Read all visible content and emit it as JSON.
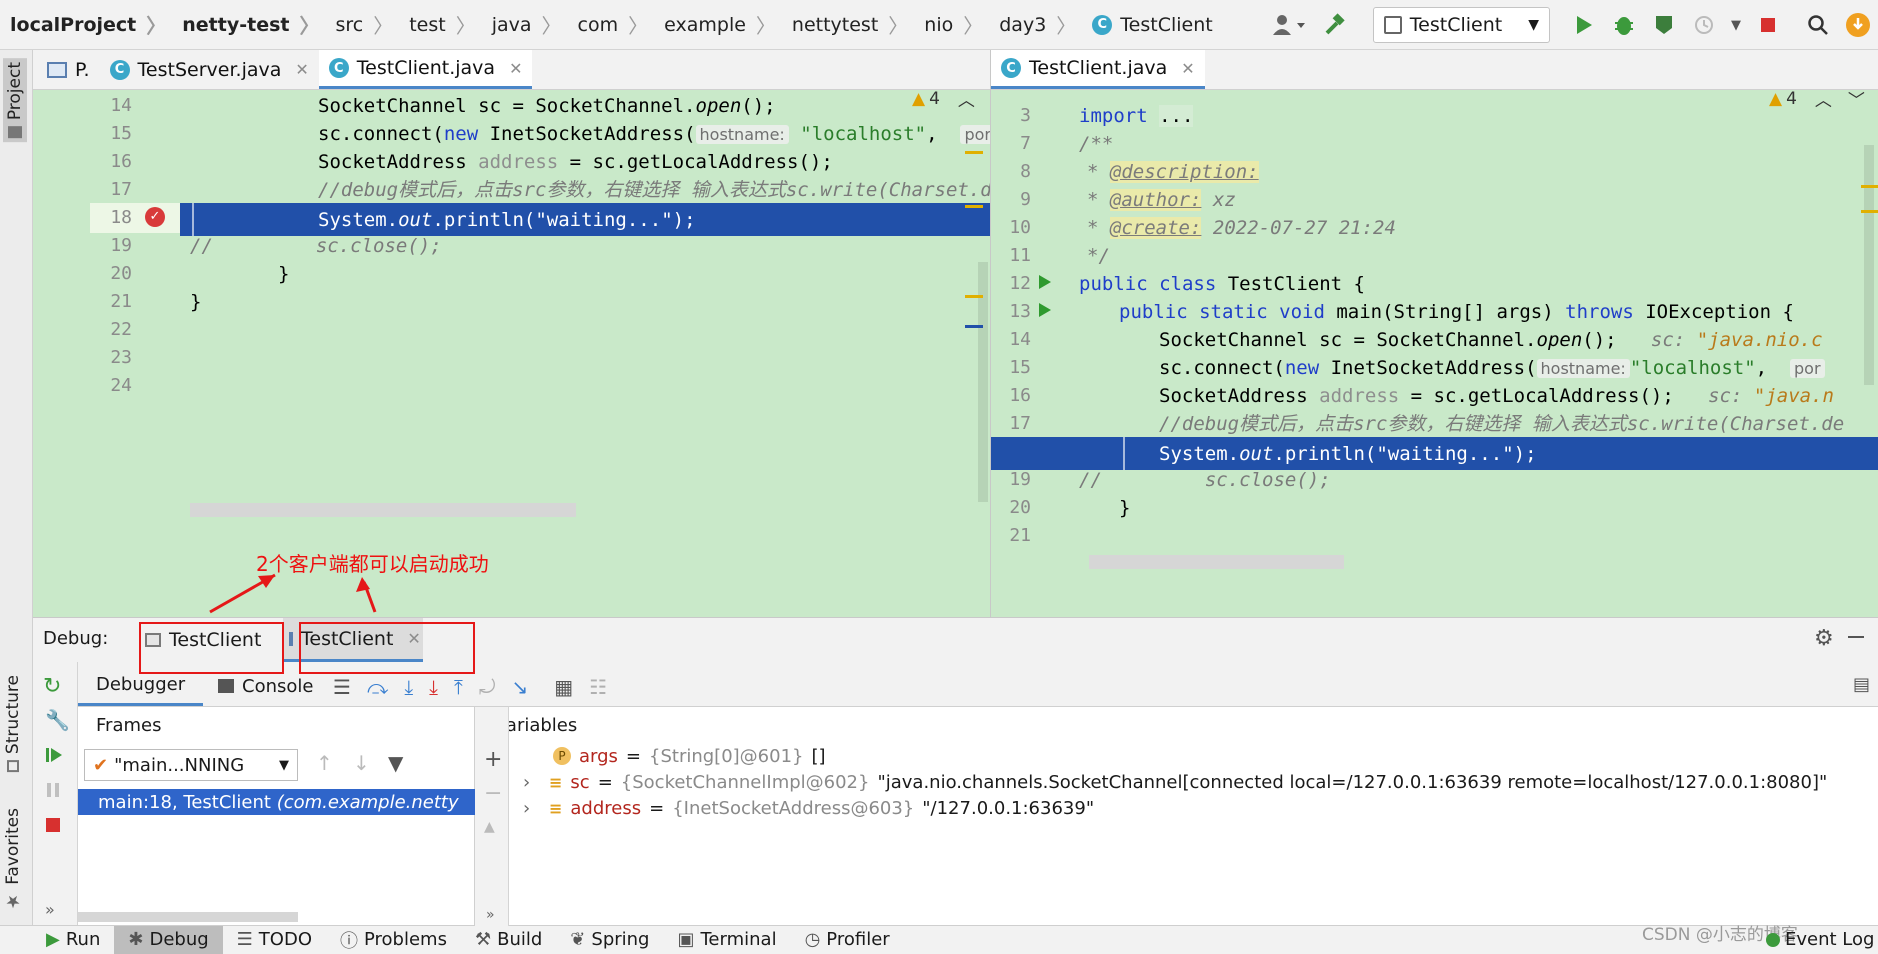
{
  "breadcrumb": [
    "localProject",
    "netty-test",
    "src",
    "test",
    "java",
    "com",
    "example",
    "nettytest",
    "nio",
    "day3",
    "TestClient"
  ],
  "toolbar": {
    "run_config": "TestClient"
  },
  "left_strip": {
    "project": "Project",
    "structure": "Structure",
    "favorites": "Favorites"
  },
  "left_editor": {
    "tabs": [
      {
        "label": "P.",
        "active": false
      },
      {
        "label": "TestServer.java",
        "active": false
      },
      {
        "label": "TestClient.java",
        "active": true
      }
    ],
    "warnings": "4",
    "lines": [
      {
        "n": "14"
      },
      {
        "n": "15"
      },
      {
        "n": "16"
      },
      {
        "n": "17"
      },
      {
        "n": "18"
      },
      {
        "n": "19"
      },
      {
        "n": "20"
      },
      {
        "n": "21"
      },
      {
        "n": "22"
      },
      {
        "n": "23"
      },
      {
        "n": "24"
      }
    ]
  },
  "right_editor": {
    "tab": "TestClient.java",
    "warnings": "4",
    "lines": [
      {
        "n": "3"
      },
      {
        "n": "7"
      },
      {
        "n": "8"
      },
      {
        "n": "9"
      },
      {
        "n": "10"
      },
      {
        "n": "11"
      },
      {
        "n": "12"
      },
      {
        "n": "13"
      },
      {
        "n": "14"
      },
      {
        "n": "15"
      },
      {
        "n": "16"
      },
      {
        "n": "17"
      },
      {
        "n": "18"
      },
      {
        "n": "19"
      },
      {
        "n": "20"
      },
      {
        "n": "21"
      }
    ]
  },
  "code": {
    "sc_decl": [
      "SocketChannel sc = SocketChannel.",
      "open",
      "();"
    ],
    "connect": [
      "sc.connect(",
      "new",
      " InetSocketAddress(",
      "hostname:",
      "\"localhost\"",
      ",",
      "port"
    ],
    "address": [
      "SocketAddress ",
      "address",
      " = sc.getLocalAddress();"
    ],
    "comment_debug": "//debug模式后，点击src参数，右键选择 输入表达式sc.write(Charset.de",
    "comment_debug_right": "//debug模式后，点击src参数，右键选择 输入表达式sc.write(Charset.de",
    "println": [
      "System.",
      "out",
      ".println(",
      "\"waiting...\"",
      ");"
    ],
    "close": [
      "//",
      "sc.close();"
    ],
    "brace": "}",
    "import": [
      "import",
      "..."
    ],
    "javadoc_open": "/**",
    "description_tag": "@description:",
    "author_tag": "@author:",
    "author_val": "xz",
    "create_tag": "@create:",
    "create_val": "2022-07-27 21:24",
    "javadoc_close": "*/",
    "class_decl": [
      "public class",
      " TestClient {"
    ],
    "main_decl": [
      "public static void",
      " main(String[] args) ",
      "throws",
      " IOException {"
    ],
    "hint_sc": [
      "sc:",
      "\"java.nio.c"
    ],
    "hint_address": [
      "sc:",
      "\"java.n"
    ],
    "star": "*",
    "port_hint": "por"
  },
  "debug": {
    "label": "Debug:",
    "sessions": [
      "TestClient",
      "TestClient"
    ],
    "subtabs": {
      "debugger": "Debugger",
      "console": "Console"
    },
    "frames_title": "Frames",
    "variables_title": "Variables",
    "thread": "\"main...NNING",
    "frame": [
      "main:18, TestClient",
      "(com.example.netty"
    ],
    "variables": [
      {
        "icon": "P",
        "name": "args",
        "type": "{String[0]@601}",
        "value": "[]"
      },
      {
        "icon": "≡",
        "name": "sc",
        "type": "{SocketChannelImpl@602}",
        "value": "\"java.nio.channels.SocketChannel[connected local=/127.0.0.1:63639 remote=localhost/127.0.0.1:8080]\""
      },
      {
        "icon": "≡",
        "name": "address",
        "type": "{InetSocketAddress@603}",
        "value": "\"/127.0.0.1:63639\""
      }
    ]
  },
  "annotation": "2个客户端都可以启动成功",
  "bottom_bar": [
    "Run",
    "Debug",
    "TODO",
    "Problems",
    "Build",
    "Spring",
    "Terminal",
    "Profiler"
  ],
  "event_log": "Event Log",
  "watermark": "CSDN @小志的博客"
}
